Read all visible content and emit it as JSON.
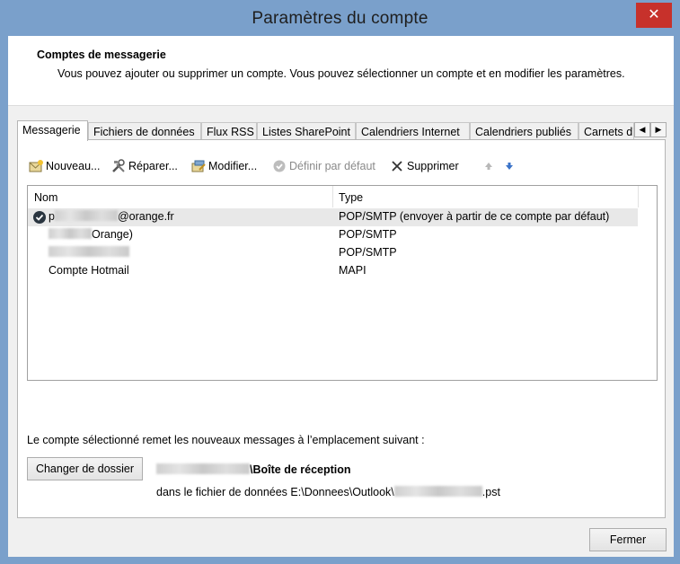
{
  "window": {
    "title": "Paramètres du compte",
    "close_glyph": "✕"
  },
  "header": {
    "title": "Comptes de messagerie",
    "description": "Vous pouvez ajouter ou supprimer un compte. Vous pouvez sélectionner un compte et en modifier les paramètres."
  },
  "tabs": [
    {
      "label": "Messagerie",
      "active": true
    },
    {
      "label": "Fichiers de données"
    },
    {
      "label": "Flux RSS"
    },
    {
      "label": "Listes SharePoint"
    },
    {
      "label": "Calendriers Internet"
    },
    {
      "label": "Calendriers publiés"
    },
    {
      "label": "Carnets d'adresses"
    }
  ],
  "tab_scroll": {
    "left": "◀",
    "right": "▶"
  },
  "toolbar": {
    "new": "Nouveau...",
    "repair": "Réparer...",
    "modify": "Modifier...",
    "set_default": "Définir par défaut",
    "remove": "Supprimer"
  },
  "list": {
    "columns": {
      "name": "Nom",
      "type": "Type"
    },
    "rows": [
      {
        "name_prefix": "p",
        "name_suffix": "@orange.fr",
        "type": "POP/SMTP (envoyer à partir de ce compte par défaut)",
        "default": true
      },
      {
        "name_suffix": "Orange)",
        "type": "POP/SMTP"
      },
      {
        "name_suffix": "",
        "type": "POP/SMTP"
      },
      {
        "name": "Compte Hotmail",
        "type": "MAPI"
      }
    ]
  },
  "delivery": {
    "label": "Le compte sélectionné remet les nouveaux messages à l’emplacement suivant :",
    "change_button": "Changer de dossier",
    "folder": "\\Boîte de réception",
    "file_prefix": "dans le fichier de données E:\\Donnees\\Outlook\\",
    "file_suffix": ".pst"
  },
  "footer": {
    "close_button": "Fermer"
  },
  "colors": {
    "titlebar": "#7aa0cb",
    "close": "#c7312b",
    "selected_row": "#e8e8e8"
  }
}
